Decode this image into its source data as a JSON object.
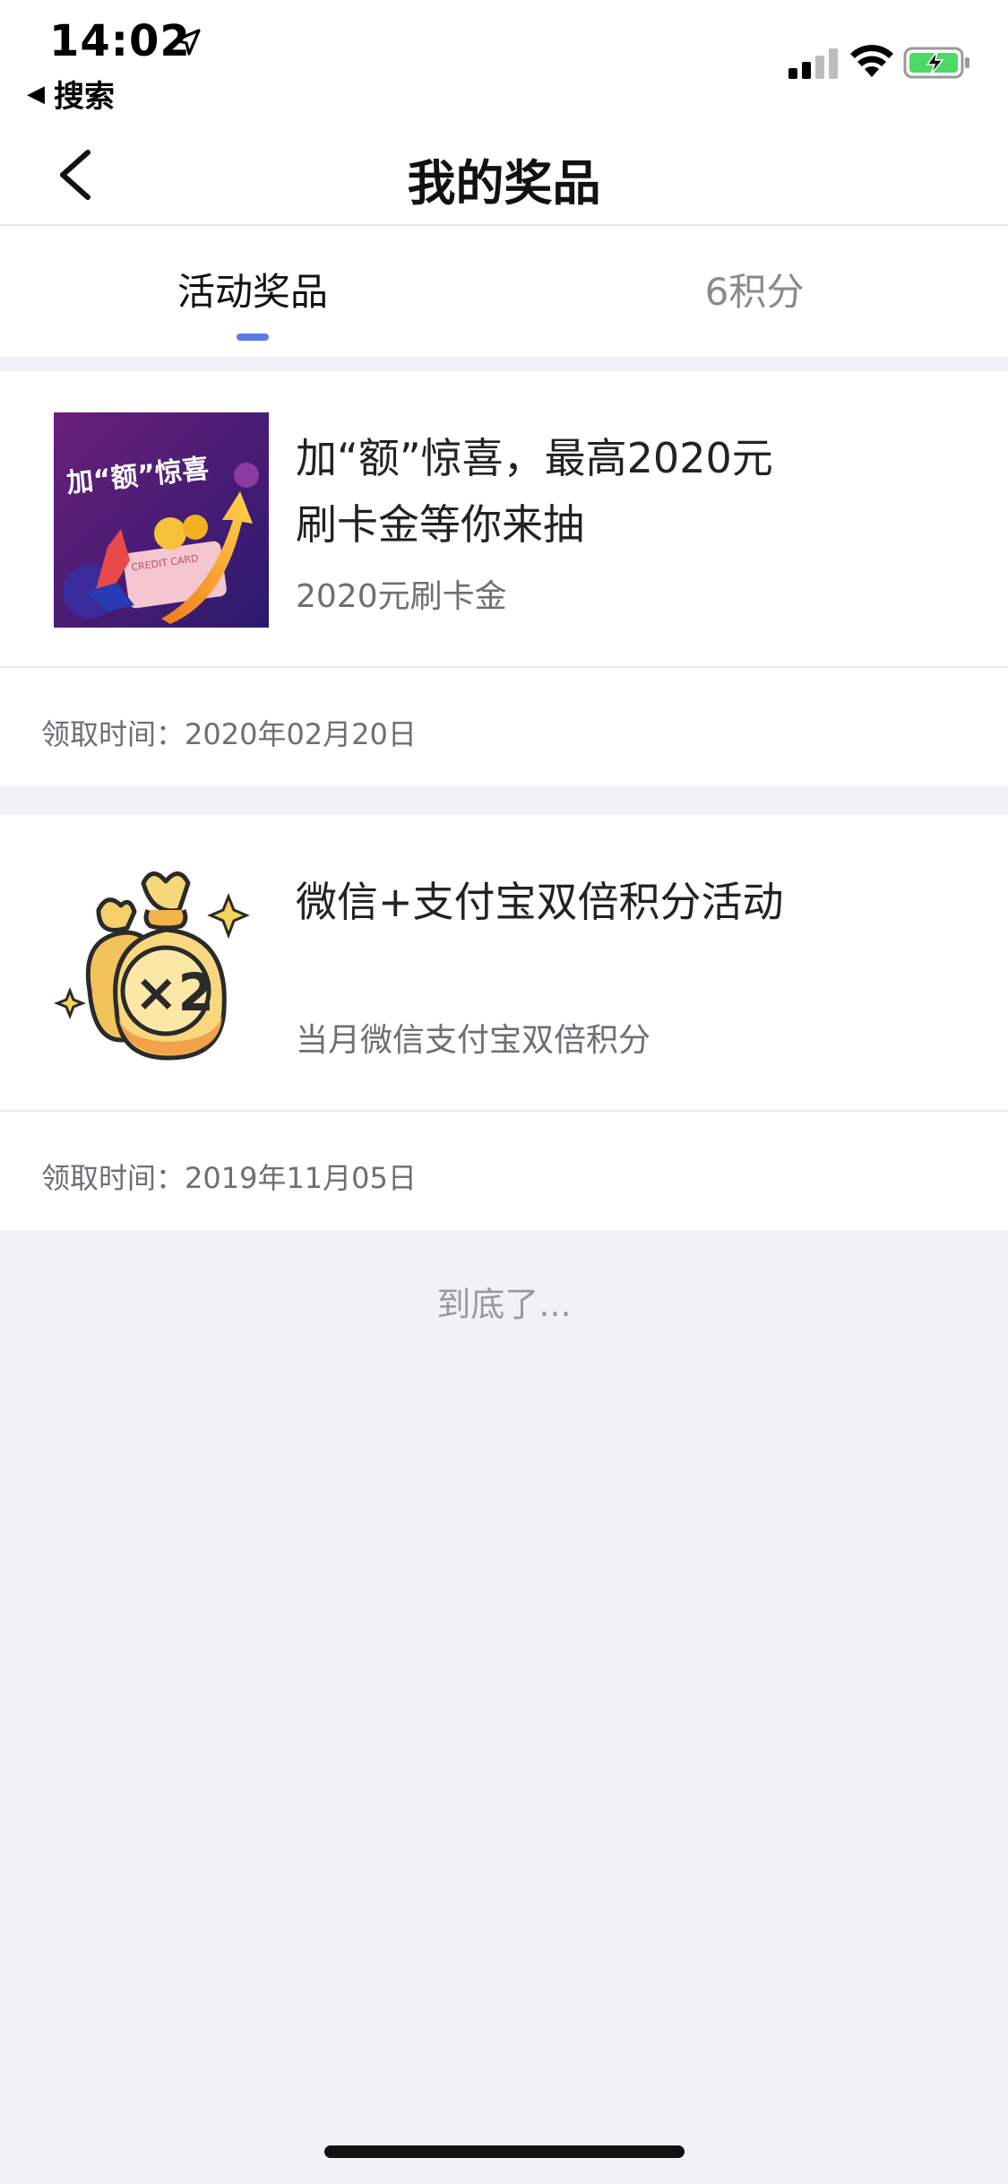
{
  "status_bar": {
    "time": "14:02",
    "back_app_label": "搜索",
    "icons": [
      "location-arrow-icon",
      "signal-icon",
      "wifi-icon",
      "battery-charging-icon"
    ],
    "battery_color": "#4cd964"
  },
  "nav": {
    "title": "我的奖品",
    "back_icon": "chevron-left-icon"
  },
  "tabs": [
    {
      "label": "活动奖品",
      "active": true
    },
    {
      "label": "6积分",
      "active": false
    }
  ],
  "accent_color": "#5a7ae6",
  "prizes": [
    {
      "title": "加“额”惊喜，最高2020元刷卡金等你来抽",
      "subtitle": "2020元刷卡金",
      "time": "领取时间：2020年02月20日",
      "image": {
        "banner_text": "加“额”惊喜",
        "card_text": "CREDIT CARD"
      }
    },
    {
      "title": "微信+支付宝双倍积分活动",
      "subtitle": "当月微信支付宝双倍积分",
      "time": "领取时间：2019年11月05日",
      "image": {
        "badge_text": "×2"
      }
    }
  ],
  "footer": {
    "end_text": "到底了..."
  }
}
